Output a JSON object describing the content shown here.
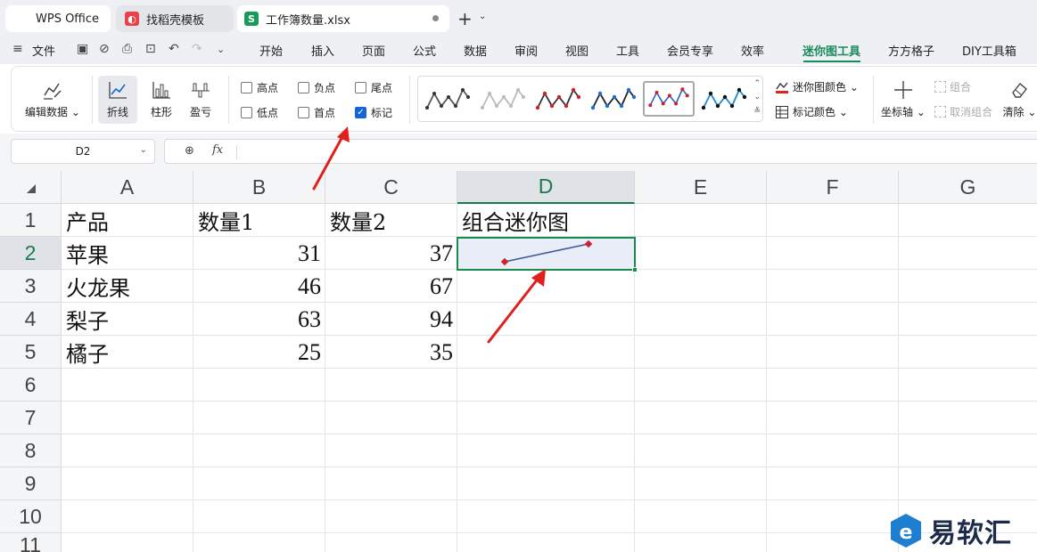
{
  "tabs": [
    {
      "label": "WPS Office"
    },
    {
      "label": "找稻壳模板"
    },
    {
      "label": "工作簿数量.xlsx"
    }
  ],
  "menu": {
    "file": "文件",
    "items": [
      "开始",
      "插入",
      "页面",
      "公式",
      "数据",
      "审阅",
      "视图",
      "工具",
      "会员专享",
      "效率",
      "迷你图工具",
      "方方格子",
      "DIY工具箱"
    ],
    "active": "迷你图工具"
  },
  "ribbon": {
    "edit_data": "编辑数据",
    "line": "折线",
    "column": "柱形",
    "winloss": "盈亏",
    "checks": {
      "high": "高点",
      "negative": "负点",
      "last": "尾点",
      "low": "低点",
      "first": "首点",
      "marker": "标记"
    },
    "marker_checked": true,
    "sparkline_color": "迷你图颜色",
    "marker_color": "标记颜色",
    "axis": "坐标轴",
    "group": "组合",
    "ungroup": "取消组合",
    "clear": "清除"
  },
  "formula_bar": {
    "name_box": "D2",
    "fx": "fx",
    "content": ""
  },
  "sheet": {
    "columns": [
      "A",
      "B",
      "C",
      "D",
      "E",
      "F",
      "G"
    ],
    "selected_column": "D",
    "rows": [
      "1",
      "2",
      "3",
      "4",
      "5",
      "6",
      "7",
      "8",
      "9",
      "10",
      "11"
    ],
    "selected_row": "2",
    "header_row": [
      "产品",
      "数量1",
      "数量2",
      "组合迷你图"
    ],
    "data": [
      {
        "product": "苹果",
        "q1": "31",
        "q2": "37"
      },
      {
        "product": "火龙果",
        "q1": "46",
        "q2": "67"
      },
      {
        "product": "梨子",
        "q1": "63",
        "q2": "94"
      },
      {
        "product": "橘子",
        "q1": "25",
        "q2": "35"
      }
    ],
    "sparkline": {
      "cell": "D2",
      "values": [
        31,
        37
      ],
      "line_color": "#3b5a9a",
      "marker_color": "#d0202a"
    }
  },
  "colors": {
    "accent": "#1a8a5c",
    "arrow": "#e0201c",
    "selection_fill": "#e9edf8"
  },
  "watermark": "易软汇"
}
